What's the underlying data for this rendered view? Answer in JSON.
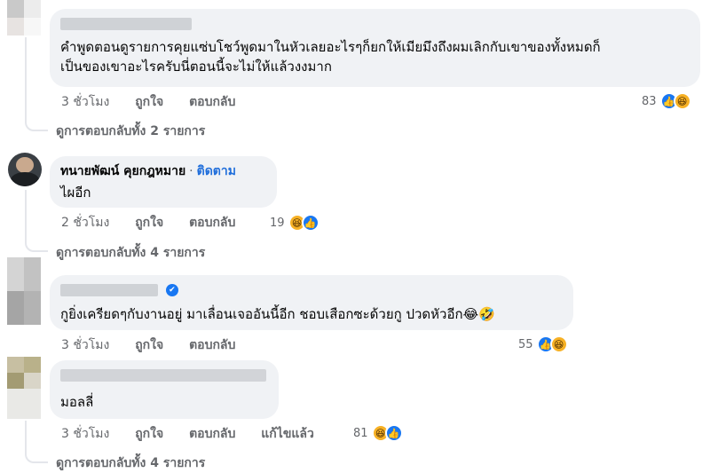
{
  "comments": [
    {
      "name": "",
      "text_lines": [
        "คำพูดตอนดูรายการคุยแซ่บโชว์พูดมาในหัวเลยอะไรๆก็ยกให้เมียมึงถึงผมเลิกกับเขาของทั้งหมดก็",
        "เป็นของเขาอะไรครับนี่ตอนนี้จะไม่ให้แล้วงงมาก"
      ],
      "time": "3 ชั่วโมง",
      "like": "ถูกใจ",
      "reply": "ตอบกลับ",
      "reaction_count": "83",
      "view_replies": "ดูการตอบกลับทั้ง 2 รายการ"
    },
    {
      "name": "ทนายพัฒน์ คุยกฎหมาย",
      "follow": "ติดตาม",
      "separator": "·",
      "text": "ไผอีก",
      "time": "2 ชั่วโมง",
      "like": "ถูกใจ",
      "reply": "ตอบกลับ",
      "reaction_count": "19",
      "view_replies": "ดูการตอบกลับทั้ง 4 รายการ"
    },
    {
      "name": "",
      "text": "กูยิ่งเครียดๆกับงานอยู่ มาเลื่อนเจออันนี้อีก ชอบเสือกซะด้วยกู ปวดหัวอีก😂🤣",
      "time": "3 ชั่วโมง",
      "like": "ถูกใจ",
      "reply": "ตอบกลับ",
      "reaction_count": "55"
    },
    {
      "name": "",
      "text": "มอลลี่",
      "time": "3 ชั่วโมง",
      "like": "ถูกใจ",
      "reply": "ตอบกลับ",
      "edited": "แก้ไขแล้ว",
      "reaction_count": "81",
      "view_replies": "ดูการตอบกลับทั้ง 4 รายการ"
    }
  ],
  "icons": {
    "like": "👍",
    "haha": "😆",
    "verified": "✔"
  },
  "colors": {
    "bubble": "#f0f2f5",
    "secondary_text": "#65676b",
    "link_blue": "#216fdb",
    "like_blue": "#1877f2",
    "haha_yellow": "#f7b125"
  }
}
